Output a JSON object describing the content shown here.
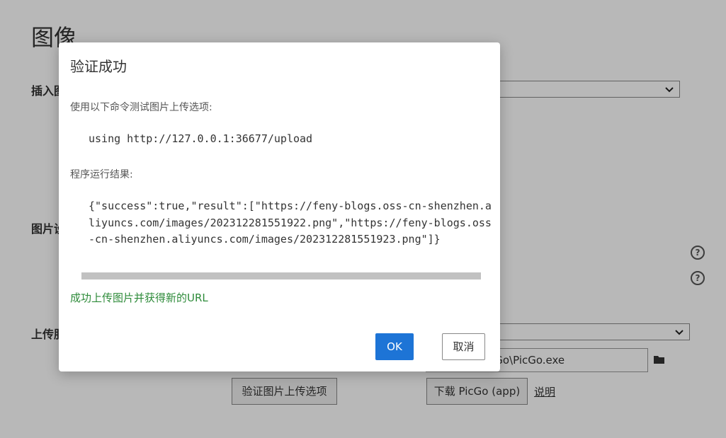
{
  "page": {
    "title": "图像",
    "insert_label": "插入图",
    "picture_label": "图片设",
    "upload_label": "上传服",
    "picgo_path": "cGo\\PicGo.exe",
    "verify_button": "验证图片上传选项",
    "download_button": "下载 PicGo (app)",
    "help_link": "说明"
  },
  "icons": {
    "select_arrow": "chevron-down-icon",
    "help": "question-circle-icon",
    "folder": "folder-icon"
  },
  "dialog": {
    "title": "验证成功",
    "test_label": "使用以下命令测试图片上传选项:",
    "command": "using http://127.0.0.1:36677/upload",
    "result_label": "程序运行结果:",
    "result": "{\"success\":true,\"result\":[\"https://feny-blogs.oss-cn-shenzhen.aliyuncs.com/images/202312281551922.png\",\"https://feny-blogs.oss-cn-shenzhen.aliyuncs.com/images/202312281551923.png\"]}",
    "success_message": "成功上传图片并获得新的URL",
    "ok": "OK",
    "cancel": "取消"
  },
  "colors": {
    "primary": "#1d74d6",
    "success": "#2e8b3a",
    "overlay": "rgba(0,0,0,0.28)"
  }
}
